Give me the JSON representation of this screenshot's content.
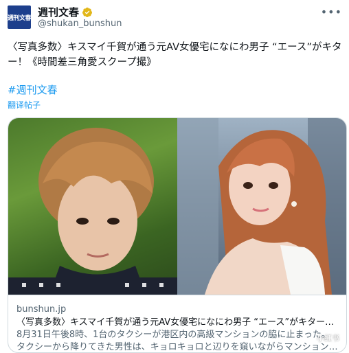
{
  "header": {
    "avatar_text": "週刊文春",
    "display_name": "週刊文春",
    "handle": "@shukan_bunshun",
    "more_label": "•••"
  },
  "tweet": {
    "text": "〈写真多数〉キスマイ千賀が通う元AV女優宅になにわ男子 “エース”がキター！《時間差三角愛スクープ撮》",
    "hashtag": "#週刊文春",
    "translate_label": "翻译帖子"
  },
  "card": {
    "domain": "bunshun.jp",
    "title": "〈写真多数〉キスマイ千賀が通う元AV女優宅になにわ男子 “エース”がキター…",
    "description_line1": "8月31日午後8時、1台のタクシーが港区内の高級マンションの脇に止まった。",
    "description_line2": "タクシーから降りてきた男性は、キョロキョロと辺りを窺いながらマンション…"
  },
  "watermark": "小红书"
}
